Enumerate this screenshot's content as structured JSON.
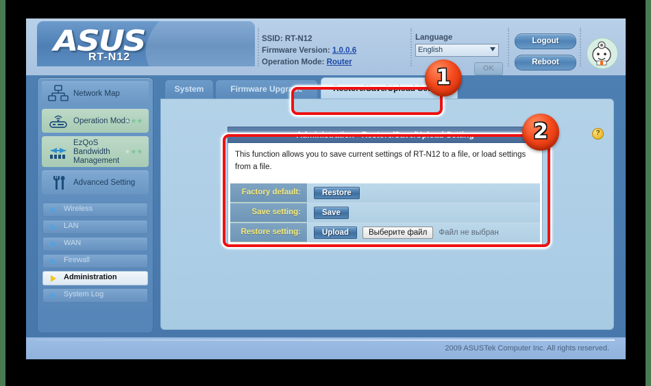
{
  "brand": {
    "logo_text": "ASUS",
    "model": "RT-N12"
  },
  "header": {
    "ssid_label": "SSID:",
    "ssid_value": "RT-N12",
    "firmware_label": "Firmware Version:",
    "firmware_value": "1.0.0.6",
    "opmode_label": "Operation Mode:",
    "opmode_value": "Router",
    "language_label": "Language",
    "language_selected": "English",
    "ok_button": "OK",
    "logout_button": "Logout",
    "reboot_button": "Reboot",
    "mascot_icon": "doctor-mascot-icon"
  },
  "sidebar": {
    "main_items": [
      {
        "label": "Network Map",
        "icon": "network-map-icon",
        "highlight": false,
        "stars": ""
      },
      {
        "label": "Operation Mode",
        "icon": "router-signal-icon",
        "highlight": true,
        "stars": "★★★"
      },
      {
        "label": "EzQoS Bandwidth Management",
        "icon": "bandwidth-icon",
        "highlight": true,
        "stars": "★★★"
      },
      {
        "label": "Advanced Setting",
        "icon": "tools-icon",
        "highlight": false,
        "stars": ""
      }
    ],
    "sub_items": [
      {
        "label": "Wireless",
        "active": false
      },
      {
        "label": "LAN",
        "active": false
      },
      {
        "label": "WAN",
        "active": false
      },
      {
        "label": "Firewall",
        "active": false
      },
      {
        "label": "Administration",
        "active": true
      },
      {
        "label": "System Log",
        "active": false
      }
    ]
  },
  "tabs": [
    {
      "label": "System",
      "selected": false
    },
    {
      "label": "Firmware Upgrade",
      "selected": false
    },
    {
      "label": "Restore/Save/Upload Setting",
      "selected": true
    }
  ],
  "panel": {
    "title": "Administration - Restore/Save/Upload Setting",
    "description": "This function allows you to save current settings of RT-N12 to a file, or load settings from a file.",
    "help_icon": "?",
    "rows": [
      {
        "label": "Factory default:",
        "primary_button": "Restore",
        "file_button": null,
        "file_status": null
      },
      {
        "label": "Save setting:",
        "primary_button": "Save",
        "file_button": null,
        "file_status": null
      },
      {
        "label": "Restore setting:",
        "primary_button": "Upload",
        "file_button": "Выберите файл",
        "file_status": "Файл не выбран"
      }
    ]
  },
  "footer": {
    "copyright": "2009 ASUSTek Computer Inc. All rights reserved."
  },
  "annotations": {
    "badges": [
      {
        "number": "1"
      },
      {
        "number": "2"
      }
    ],
    "accent_color": "#ee1111"
  }
}
